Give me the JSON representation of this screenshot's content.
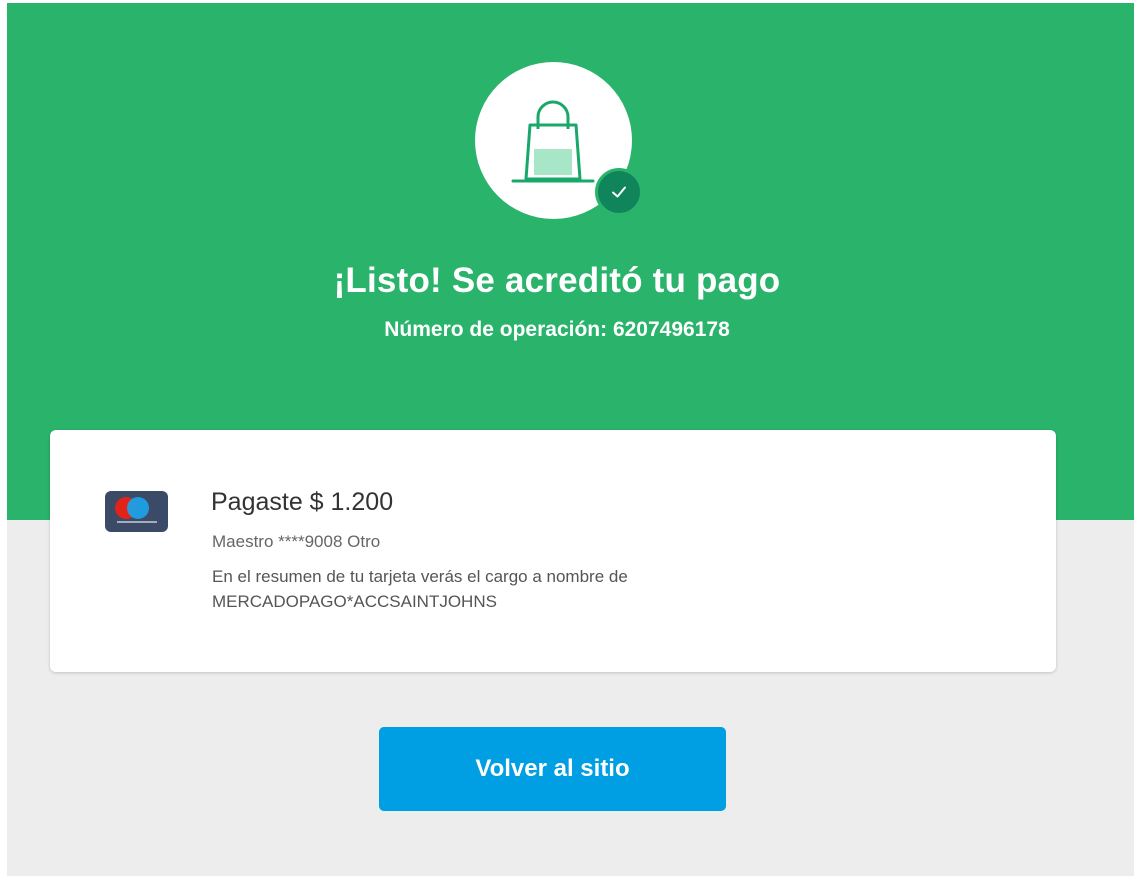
{
  "header": {
    "title": "¡Listo! Se acreditó tu pago",
    "operation_label": "Número de operación:",
    "operation_number": "6207496178",
    "operation_text": "Número de operación: 6207496178",
    "main_icon": "shopping-bag-icon",
    "badge_icon": "check-icon"
  },
  "payment": {
    "card_brand_icon": "maestro-card-icon",
    "amount_text": "Pagaste $ 1.200",
    "method_text": "Maestro ****9008 Otro",
    "statement_note_line1": "En el resumen de tu tarjeta verás el cargo a nombre de",
    "statement_note_line2": "MERCADOPAGO*ACCSAINTJOHNS"
  },
  "actions": {
    "back_label": "Volver al sitio"
  },
  "colors": {
    "hero_green": "#29b36b",
    "badge_green": "#10845a",
    "button_blue": "#009ee3",
    "page_background": "#ededed"
  }
}
